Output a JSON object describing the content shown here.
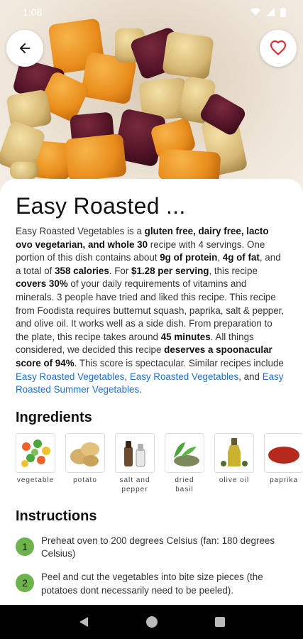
{
  "status": {
    "time": "1:08"
  },
  "recipe": {
    "title": "Easy Roasted ...",
    "summary_parts": [
      {
        "t": "Easy Roasted Vegetables is a ",
        "b": false
      },
      {
        "t": "gluten free, dairy free, lacto ovo vegetarian, and whole 30",
        "b": true
      },
      {
        "t": " recipe with 4 servings. One portion of this dish contains about ",
        "b": false
      },
      {
        "t": "9g of protein",
        "b": true
      },
      {
        "t": ", ",
        "b": false
      },
      {
        "t": "4g of fat",
        "b": true
      },
      {
        "t": ", and a total of ",
        "b": false
      },
      {
        "t": "358 calories",
        "b": true
      },
      {
        "t": ". For ",
        "b": false
      },
      {
        "t": "$1.28 per serving",
        "b": true
      },
      {
        "t": ", this recipe ",
        "b": false
      },
      {
        "t": "covers 30%",
        "b": true
      },
      {
        "t": " of your daily requirements of vitamins and minerals. 3 people have tried and liked this recipe. This recipe from Foodista requires butternut squash, paprika, salt & pepper, and olive oil. It works well as a side dish. From preparation to the plate, this recipe takes around ",
        "b": false
      },
      {
        "t": "45 minutes",
        "b": true
      },
      {
        "t": ". All things considered, we decided this recipe ",
        "b": false
      },
      {
        "t": "deserves a spoonacular score of 94%",
        "b": true
      },
      {
        "t": ". This score is spectacular. Similar recipes include ",
        "b": false
      },
      {
        "t": "Easy Roasted Vegetables",
        "link": true
      },
      {
        "t": ", ",
        "b": false
      },
      {
        "t": "Easy Roasted Vegetables",
        "link": true
      },
      {
        "t": ", and ",
        "b": false
      },
      {
        "t": "Easy Roasted Summer Vegetables",
        "link": true
      },
      {
        "t": ".",
        "b": false
      }
    ]
  },
  "ingredients": {
    "title": "Ingredients",
    "items": [
      {
        "label": "vegetable",
        "icon": "mixed-vegetables-icon"
      },
      {
        "label": "potato",
        "icon": "potato-icon"
      },
      {
        "label": "salt and pepper",
        "icon": "salt-pepper-icon"
      },
      {
        "label": "dried basil",
        "icon": "dried-basil-icon"
      },
      {
        "label": "olive oil",
        "icon": "olive-oil-icon"
      },
      {
        "label": "paprika",
        "icon": "paprika-icon"
      }
    ]
  },
  "instructions": {
    "title": "Instructions",
    "steps": [
      {
        "num": "1",
        "text": "Preheat oven to 200 degrees Celsius (fan: 180 degrees Celsius)"
      },
      {
        "num": "2",
        "text": "Peel and cut the vegetables into bite size pieces (the potatoes dont necessarily need to be peeled)."
      }
    ]
  },
  "colors": {
    "accent_green": "#6bb34a",
    "link_blue": "#1f6fd0",
    "favorite_red": "#d9303a"
  }
}
